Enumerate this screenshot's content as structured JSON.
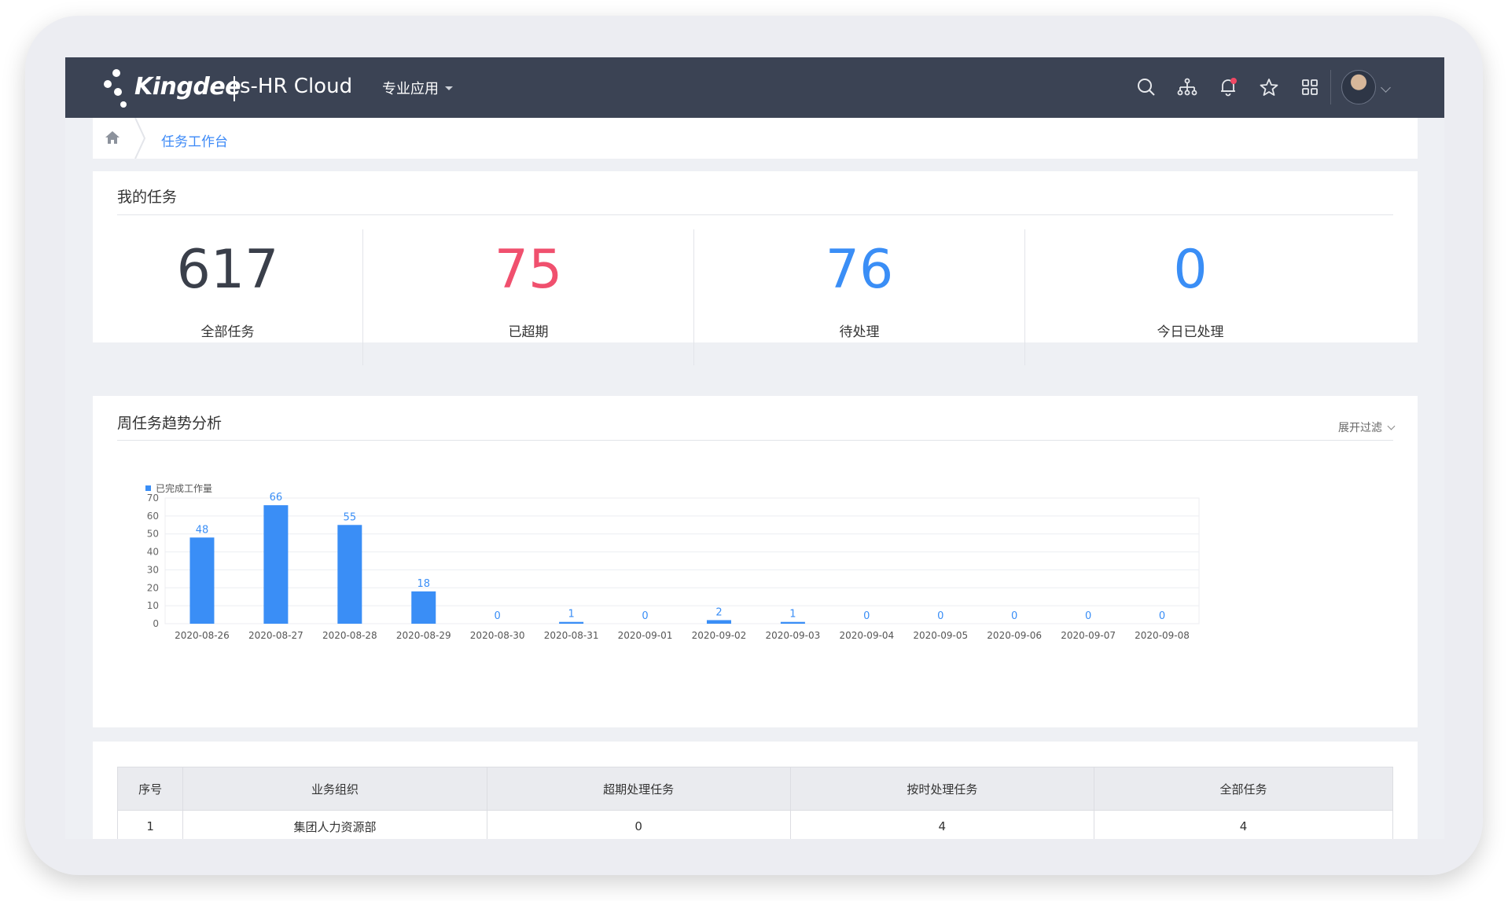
{
  "app": {
    "brand": "Kingdee",
    "product": "s-HR Cloud",
    "menu_pro": "专业应用"
  },
  "topbar_icons": [
    "search-icon",
    "org-chart-icon",
    "bell-icon",
    "star-icon",
    "apps-grid-icon"
  ],
  "breadcrumb": {
    "current": "任务工作台"
  },
  "my_tasks": {
    "title": "我的任务",
    "stats": [
      {
        "value": "617",
        "label": "全部任务",
        "color": "#3a3f4a"
      },
      {
        "value": "75",
        "label": "已超期",
        "color": "#f0506e"
      },
      {
        "value": "76",
        "label": "待处理",
        "color": "#3a8ef6"
      },
      {
        "value": "0",
        "label": "今日已处理",
        "color": "#3a8ef6"
      }
    ]
  },
  "trend": {
    "title": "周任务趋势分析",
    "filter_label": "展开过滤"
  },
  "chart_data": {
    "type": "bar",
    "categories": [
      "2020-08-26",
      "2020-08-27",
      "2020-08-28",
      "2020-08-29",
      "2020-08-30",
      "2020-08-31",
      "2020-09-01",
      "2020-09-02",
      "2020-09-03",
      "2020-09-04",
      "2020-09-05",
      "2020-09-06",
      "2020-09-07",
      "2020-09-08"
    ],
    "series": [
      {
        "name": "已完成工作量",
        "values": [
          48,
          66,
          55,
          18,
          0,
          1,
          0,
          2,
          1,
          0,
          0,
          0,
          0,
          0
        ]
      }
    ],
    "yticks": [
      0,
      10,
      20,
      30,
      40,
      50,
      60,
      70
    ],
    "ylim": [
      0,
      70
    ],
    "color": "#3a8ef6",
    "grid": true,
    "legend": "top-left"
  },
  "table": {
    "headers": [
      "序号",
      "业务组织",
      "超期处理任务",
      "按时处理任务",
      "全部任务"
    ],
    "rows": [
      [
        "1",
        "集团人力资源部",
        "0",
        "4",
        "4"
      ]
    ]
  }
}
